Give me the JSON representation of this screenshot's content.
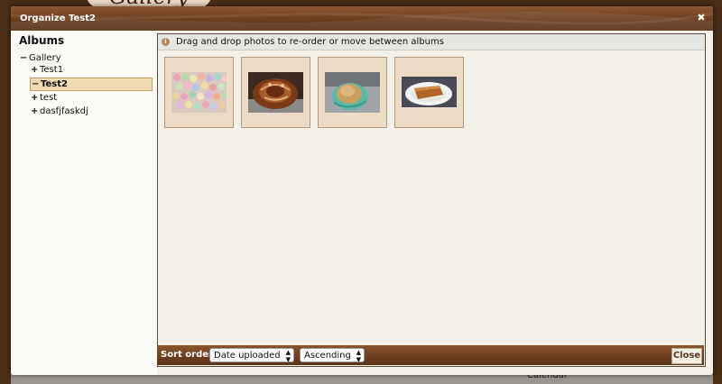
{
  "dialog": {
    "title": "Organize Test2",
    "close_symbol": "✖"
  },
  "albums": {
    "heading": "Albums",
    "tree": [
      {
        "sign": "−",
        "label": "Gallery",
        "expanded": true
      },
      {
        "sign": "+",
        "label": "Test1"
      },
      {
        "sign": "−",
        "label": "Test2",
        "selected": true
      },
      {
        "sign": "+",
        "label": "test"
      },
      {
        "sign": "+",
        "label": "dasfjfaskdj"
      }
    ]
  },
  "info": {
    "icon": "info-icon",
    "text": "Drag and drop photos to re-order or move between albums"
  },
  "thumbnails": [
    {
      "name": "candy-photo"
    },
    {
      "name": "cinnamon-roll-photo"
    },
    {
      "name": "cupcake-photo"
    },
    {
      "name": "cake-slice-photo"
    }
  ],
  "toolbar": {
    "sort_label": "Sort order",
    "sort_by": {
      "selected": "Date uploaded"
    },
    "direction": {
      "selected": "Ascending"
    },
    "close_label": "Close"
  },
  "background": {
    "logo_text": "Gallery",
    "calendar_text": "Calendar"
  },
  "colors": {
    "brown_dark": "#5a3318",
    "brown": "#8a5630",
    "selected_bg": "#f1d9b4",
    "thumb_bg": "#ecdcc6"
  }
}
